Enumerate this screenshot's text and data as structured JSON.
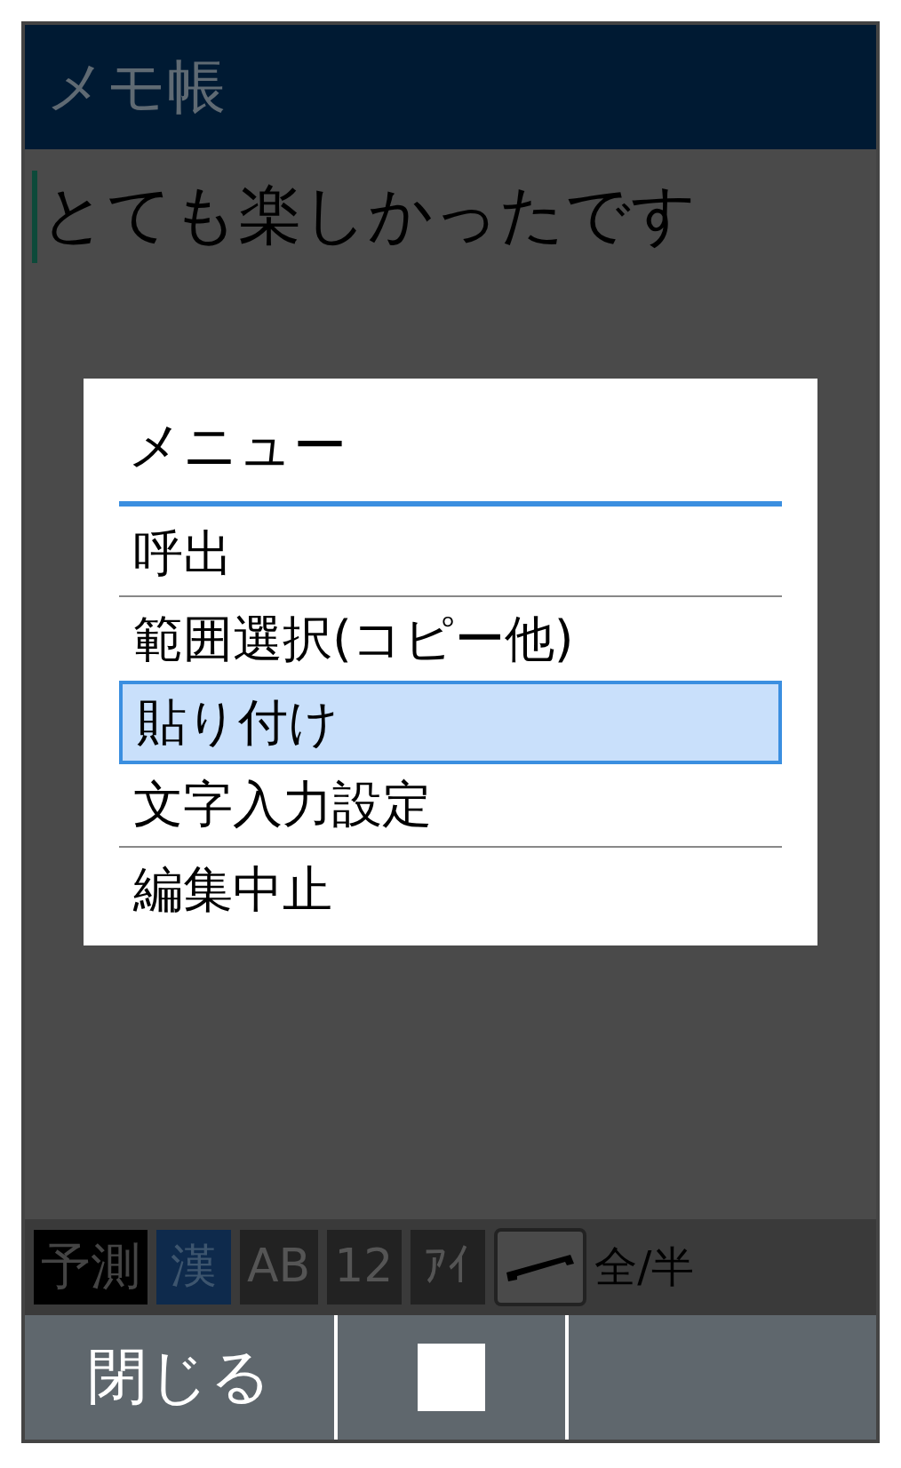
{
  "window": {
    "title": "メモ帳"
  },
  "memo": {
    "text": "とても楽しかったです"
  },
  "menu": {
    "title": "メニュー",
    "items": [
      {
        "label": "呼出",
        "selected": false
      },
      {
        "label": "範囲選択(コピー他)",
        "selected": false
      },
      {
        "label": "貼り付け",
        "selected": true
      },
      {
        "label": "文字入力設定",
        "selected": false
      },
      {
        "label": "編集中止",
        "selected": false
      }
    ]
  },
  "input_bar": {
    "prediction": {
      "label": "予測",
      "on": true
    },
    "modes": [
      {
        "label": "漢",
        "selected": true
      },
      {
        "label": "AB",
        "selected": false
      },
      {
        "label": "12",
        "selected": false
      },
      {
        "label": "ｱｲ",
        "selected": false
      }
    ],
    "width_toggle": "全/半"
  },
  "softkeys": [
    {
      "kind": "text",
      "label": "閉じる"
    },
    {
      "kind": "icon"
    },
    {
      "kind": "empty"
    }
  ]
}
